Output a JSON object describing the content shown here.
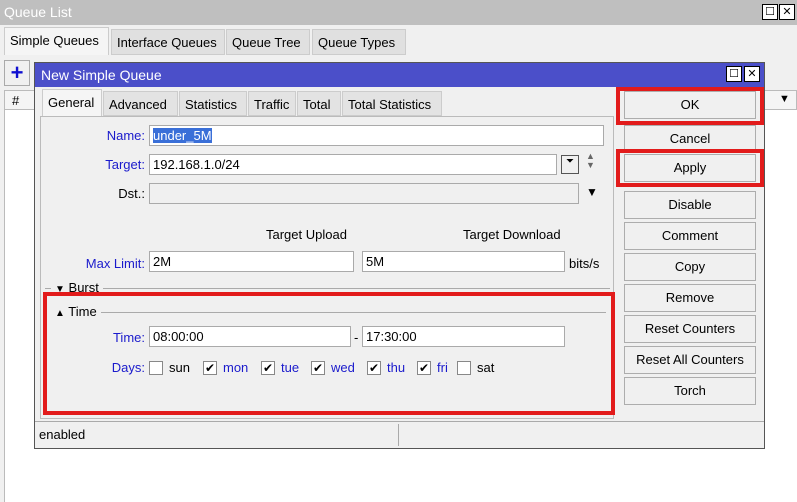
{
  "window": {
    "title": "Queue List"
  },
  "tabs": [
    "Simple Queues",
    "Interface Queues",
    "Queue Tree",
    "Queue Types"
  ],
  "table": {
    "col_hash": "#"
  },
  "dialog": {
    "title": "New Simple Queue",
    "tabs": [
      "General",
      "Advanced",
      "Statistics",
      "Traffic",
      "Total",
      "Total Statistics"
    ],
    "name_label": "Name:",
    "name_value": "under_5M",
    "target_label": "Target:",
    "target_value": "192.168.1.0/24",
    "dst_label": "Dst.:",
    "dst_value": "",
    "upload_header": "Target Upload",
    "download_header": "Target Download",
    "maxlimit_label": "Max Limit:",
    "upload_value": "2M",
    "download_value": "5M",
    "unit": "bits/s",
    "burst_label": "Burst",
    "time_section": "Time",
    "time_label": "Time:",
    "time_start": "08:00:00",
    "time_sep": "-",
    "time_end": "17:30:00",
    "days_label": "Days:",
    "days": [
      {
        "label": "sun",
        "checked": false
      },
      {
        "label": "mon",
        "checked": true
      },
      {
        "label": "tue",
        "checked": true
      },
      {
        "label": "wed",
        "checked": true
      },
      {
        "label": "thu",
        "checked": true
      },
      {
        "label": "fri",
        "checked": true
      },
      {
        "label": "sat",
        "checked": false
      }
    ],
    "status": "enabled",
    "buttons": [
      "OK",
      "Cancel",
      "Apply",
      "Disable",
      "Comment",
      "Copy",
      "Remove",
      "Reset Counters",
      "Reset All Counters",
      "Torch"
    ],
    "highlight_color": "#e21b1b",
    "title_color": "#4b4fc9"
  }
}
